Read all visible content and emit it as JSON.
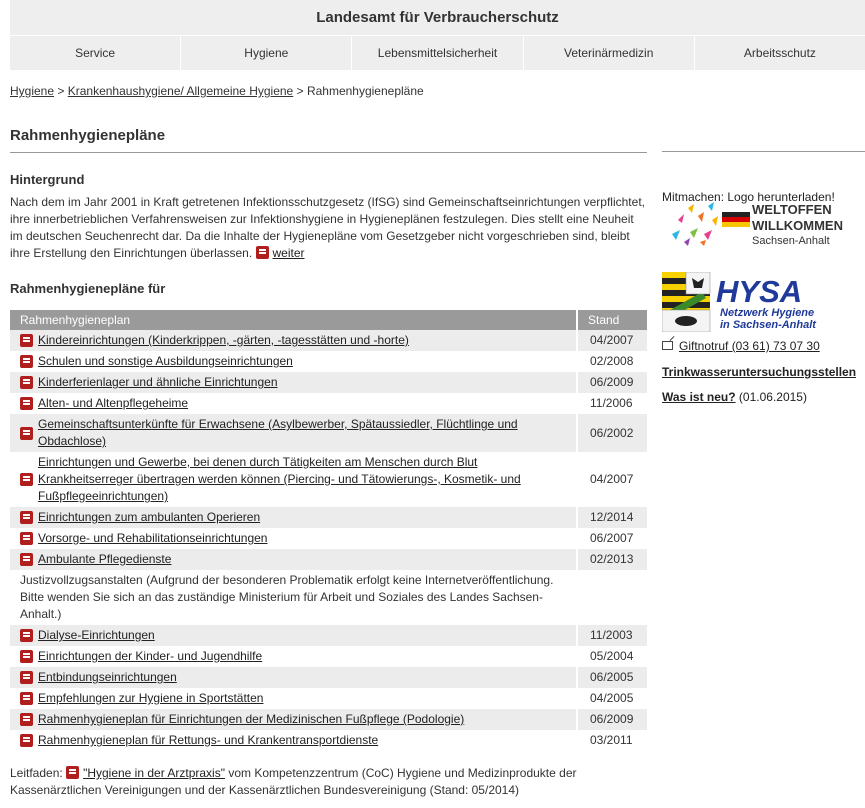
{
  "header": {
    "title": "Landesamt für Verbraucherschutz"
  },
  "nav": [
    {
      "label": "Service"
    },
    {
      "label": "Hygiene"
    },
    {
      "label": "Lebensmittelsicherheit"
    },
    {
      "label": "Veterinärmedizin"
    },
    {
      "label": "Arbeitsschutz"
    }
  ],
  "breadcrumb": {
    "item1": "Hygiene",
    "sep": ">",
    "item2": "Krankenhaushygiene/ Allgemeine Hygiene",
    "current": "Rahmenhygienepläne"
  },
  "page_title": "Rahmenhygienepläne",
  "hintergrund": {
    "heading": "Hintergrund",
    "text": "Nach dem im Jahr 2001 in Kraft getretenen Infektionsschutzgesetz (IfSG) sind Gemeinschaftseinrichtungen verpflichtet, ihre innerbetrieblichen Verfahrensweisen zur Infektionshygiene in Hygieneplänen festzulegen. Dies stellt eine Neuheit im deutschen Seuchenrecht dar. Da die Inhalte der Hygienepläne vom Gesetzgeber nicht vorgeschrieben sind, bleibt ihre Erstellung den Einrichtungen überlassen.",
    "more_link": "weiter"
  },
  "plans": {
    "heading": "Rahmenhygienepläne für",
    "col_name": "Rahmenhygieneplan",
    "col_stand": "Stand",
    "rows": [
      {
        "name": "Kindereinrichtungen (Kinderkrippen, -gärten, -tagesstätten und -horte)",
        "stand": "04/2007",
        "pdf": true
      },
      {
        "name": "Schulen und sonstige Ausbildungseinrichtungen",
        "stand": "02/2008",
        "pdf": true
      },
      {
        "name": "Kinderferienlager und ähnliche Einrichtungen",
        "stand": "06/2009",
        "pdf": true
      },
      {
        "name": "Alten- und Altenpflegeheime",
        "stand": "11/2006",
        "pdf": true
      },
      {
        "name": "Gemeinschaftsunterkünfte für Erwachsene (Asylbewerber, Spätaussiedler, Flüchtlinge und Obdachlose)",
        "stand": "06/2002",
        "pdf": true
      },
      {
        "name": "Einrichtungen und Gewerbe, bei denen durch Tätigkeiten am Menschen durch Blut Krankheitserreger übertragen werden können (Piercing- und Tätowierungs-, Kosmetik- und Fußpflegeeinrichtungen)",
        "stand": "04/2007",
        "pdf": true
      },
      {
        "name": "Einrichtungen zum ambulanten Operieren",
        "stand": "12/2014",
        "pdf": true
      },
      {
        "name": "Vorsorge- und Rehabilitationseinrichtungen",
        "stand": "06/2007",
        "pdf": true
      },
      {
        "name": "Ambulante Pflegedienste",
        "stand": "02/2013",
        "pdf": true
      },
      {
        "name": "Justizvollzugsanstalten (Aufgrund der besonderen Problematik erfolgt keine Internetveröffentlichung. Bitte wenden Sie sich an das zuständige Ministerium für Arbeit und Soziales des Landes Sachsen-Anhalt.)",
        "stand": "",
        "pdf": false
      },
      {
        "name": "Dialyse-Einrichtungen",
        "stand": "11/2003",
        "pdf": true
      },
      {
        "name": "Einrichtungen der Kinder- und Jugendhilfe",
        "stand": "05/2004",
        "pdf": true
      },
      {
        "name": "Entbindungseinrichtungen",
        "stand": "06/2005",
        "pdf": true
      },
      {
        "name": "Empfehlungen zur Hygiene in Sportstätten",
        "stand": "04/2005",
        "pdf": true
      },
      {
        "name": "Rahmenhygieneplan für Einrichtungen der Medizinischen Fußpflege (Podologie)",
        "stand": "06/2009",
        "pdf": true
      },
      {
        "name": "Rahmenhygieneplan für Rettungs- und Krankentransportdienste",
        "stand": "03/2011",
        "pdf": true
      }
    ]
  },
  "leitfaden": {
    "prefix": "Leitfaden:",
    "link": "\"Hygiene in der Arztpraxis\"",
    "suffix": "vom Kompetenzzentrum (CoC) Hygiene und Medizinprodukte der Kassenärztlichen Vereinigungen und der Kassenärztlichen Bundesvereinigung (Stand: 05/2014)"
  },
  "sidebar": {
    "mitmachen": "Mitmachen: Logo herunterladen!",
    "logo1": {
      "line1": "WELTOFFEN",
      "line2": "WILLKOMMEN",
      "line3": "Sachsen-Anhalt"
    },
    "logo2": {
      "title": "HYSA",
      "sub1": "Netzwerk Hygiene",
      "sub2": "in Sachsen-Anhalt"
    },
    "giftnotruf": "Giftnotruf (03 61) 73 07 30",
    "trinkwasser": "Trinkwasseruntersuchungsstellen",
    "was_ist_neu": "Was ist neu?",
    "was_ist_neu_date": "(01.06.2015)"
  },
  "colors": {
    "header_bg": "#eeeeee",
    "table_header": "#9a9a9a",
    "row_shade": "#ececec",
    "pdf_red": "#b11e1e",
    "hysa_blue": "#1f3a9a"
  }
}
